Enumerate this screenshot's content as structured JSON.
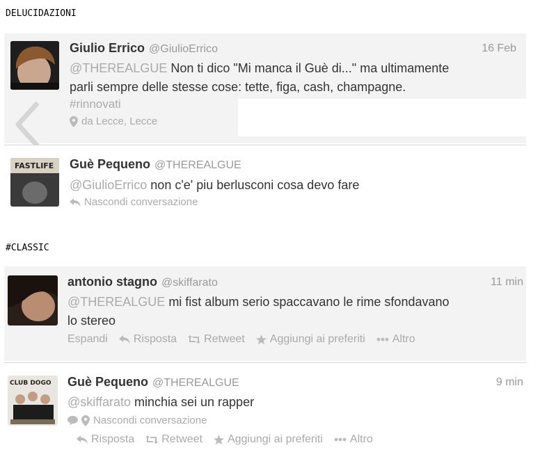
{
  "sections": {
    "delucidazioni": "DELUCIDAZIONI",
    "classic": "#CLASSIC"
  },
  "tweet1": {
    "name": "Giulio Errico",
    "handle": "@GiulioErrico",
    "date": "16 Feb",
    "mention": "@THEREALGUE",
    "text_line1": " Non ti dico \"Mi manca il Guè di...\" ma ultimamente",
    "text_line2": "parli sempre delle stesse cose: tette, figa, cash, champagne.",
    "hashtag": "#rinnovati",
    "location": "da Lecce, Lecce",
    "icons": [
      "avatar",
      "back-arrow-icon",
      "location-pin-icon"
    ]
  },
  "tweet2": {
    "name": "Guè Pequeno",
    "handle": "@THEREALGUE",
    "mention": "@GiulioErrico",
    "text": " non c'e' piu berlusconi cosa devo fare",
    "hide_conversation": "Nascondi conversazione"
  },
  "tweet3": {
    "name": "antonio stagno",
    "handle": "@skiffarato",
    "date": "11 min",
    "mention": "@THEREALGUE",
    "text_line1": " mi fist album serio spaccavano le rime sfondavano",
    "text_line2": "lo stereo",
    "actions": {
      "expand": "Espandi",
      "reply": "Risposta",
      "retweet": "Retweet",
      "favorite": "Aggiungi ai preferiti",
      "more": "Altro"
    }
  },
  "tweet4": {
    "name": "Guè Pequeno",
    "handle": "@THEREALGUE",
    "date": "9 min",
    "mention": "@skiffarato",
    "text": " minchia sei un rapper",
    "hide_conversation": "Nascondi conversazione",
    "actions": {
      "reply": "Risposta",
      "retweet": "Retweet",
      "favorite": "Aggiungi ai preferiti",
      "more": "Altro"
    }
  },
  "colors": {
    "tweet_bg": "#f3f3f3",
    "muted": "#aaaaaa",
    "text": "#333333"
  }
}
